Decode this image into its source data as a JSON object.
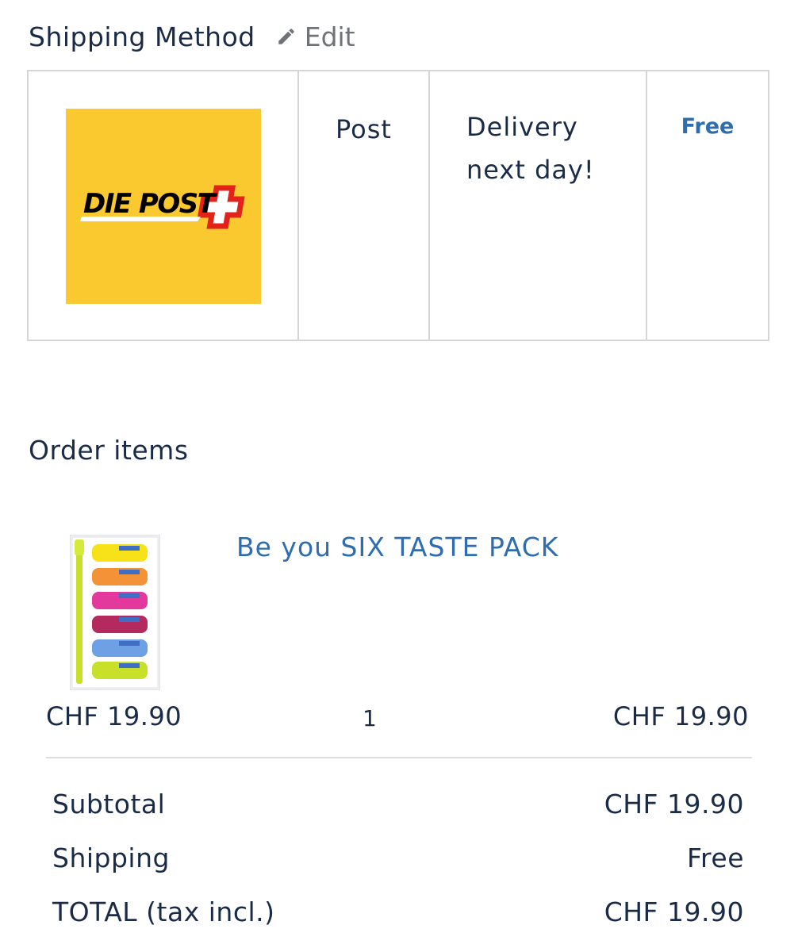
{
  "shipping_method": {
    "title": "Shipping Method",
    "edit_label": "Edit",
    "edit_icon": "pencil-icon",
    "carrier": {
      "logo_text": "DIE POST",
      "logo_colors": {
        "background": "#F9C92F",
        "cross": "#E2231A",
        "text": "#000000"
      },
      "name": "Post",
      "description_line1": "Delivery",
      "description_line2": "next day!",
      "price": "Free"
    }
  },
  "order_items": {
    "title": "Order items",
    "items": [
      {
        "name": "Be you SIX TASTE PACK",
        "unit_price": "CHF 19.90",
        "quantity": "1",
        "line_total": "CHF 19.90"
      }
    ]
  },
  "totals": {
    "subtotal_label": "Subtotal",
    "subtotal_value": "CHF 19.90",
    "shipping_label": "Shipping",
    "shipping_value": "Free",
    "total_label": "TOTAL (tax incl.)",
    "total_value": "CHF 19.90"
  },
  "colors": {
    "heading": "#1A2B47",
    "link": "#2E6DB0",
    "muted": "#6F7377",
    "border": "#D6D6D6"
  }
}
